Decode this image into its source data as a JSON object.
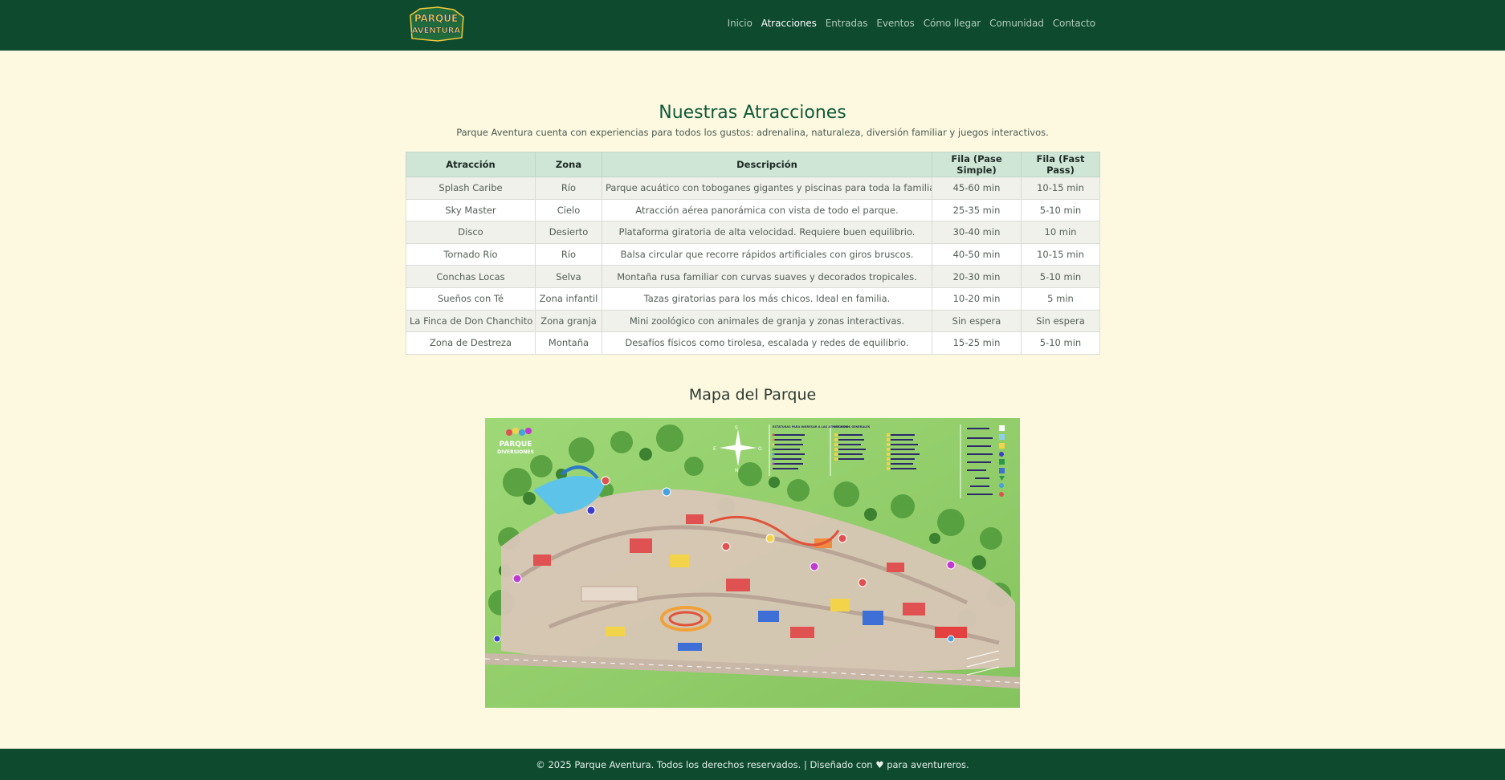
{
  "brand": {
    "logo_line1": "PARQUE",
    "logo_line2": "AVENTURA"
  },
  "nav": {
    "items": [
      "Inicio",
      "Atracciones",
      "Entradas",
      "Eventos",
      "Cómo llegar",
      "Comunidad",
      "Contacto"
    ],
    "active": "Atracciones"
  },
  "page": {
    "title": "Nuestras Atracciones",
    "intro": "Parque Aventura cuenta con experiencias para todos los gustos: adrenalina, naturaleza, diversión familiar y juegos interactivos."
  },
  "table": {
    "headers": [
      "Atracción",
      "Zona",
      "Descripción",
      "Fila (Pase Simple)",
      "Fila (Fast Pass)"
    ],
    "rows": [
      [
        "Splash Caribe",
        "Río",
        "Parque acuático con toboganes gigantes y piscinas para toda la familia.",
        "45-60 min",
        "10-15 min"
      ],
      [
        "Sky Master",
        "Cielo",
        "Atracción aérea panorámica con vista de todo el parque.",
        "25-35 min",
        "5-10 min"
      ],
      [
        "Disco",
        "Desierto",
        "Plataforma giratoria de alta velocidad. Requiere buen equilibrio.",
        "30-40 min",
        "10 min"
      ],
      [
        "Tornado Río",
        "Río",
        "Balsa circular que recorre rápidos artificiales con giros bruscos.",
        "40-50 min",
        "10-15 min"
      ],
      [
        "Conchas Locas",
        "Selva",
        "Montaña rusa familiar con curvas suaves y decorados tropicales.",
        "20-30 min",
        "5-10 min"
      ],
      [
        "Sueños con Té",
        "Zona infantil",
        "Tazas giratorias para los más chicos. Ideal en familia.",
        "10-20 min",
        "5 min"
      ],
      [
        "La Finca de Don Chanchito",
        "Zona granja",
        "Mini zoológico con animales de granja y zonas interactivas.",
        "Sin espera",
        "Sin espera"
      ],
      [
        "Zona de Destreza",
        "Montaña",
        "Desafíos físicos como tirolesa, escalada y redes de equilibrio.",
        "15-25 min",
        "5-10 min"
      ]
    ]
  },
  "map": {
    "heading": "Mapa del Parque",
    "brand_line1": "PARQUE",
    "brand_line2": "DIVERSIONES",
    "compass": {
      "n": "N",
      "s": "S",
      "e": "E",
      "o": "O"
    },
    "legend_title_1": "ESTATURAS PARA INGRESAR A LAS ATRACCIONES",
    "legend_title_2": "SERVICIOS GENERALES"
  },
  "footer": {
    "text": "© 2025 Parque Aventura. Todos los derechos reservados. | Diseñado con ♥ para aventureros."
  },
  "colors": {
    "header_bg": "#0d4a2e",
    "page_bg": "#fdf9e1",
    "title": "#0f5a39",
    "table_header": "#cfe6d7"
  }
}
